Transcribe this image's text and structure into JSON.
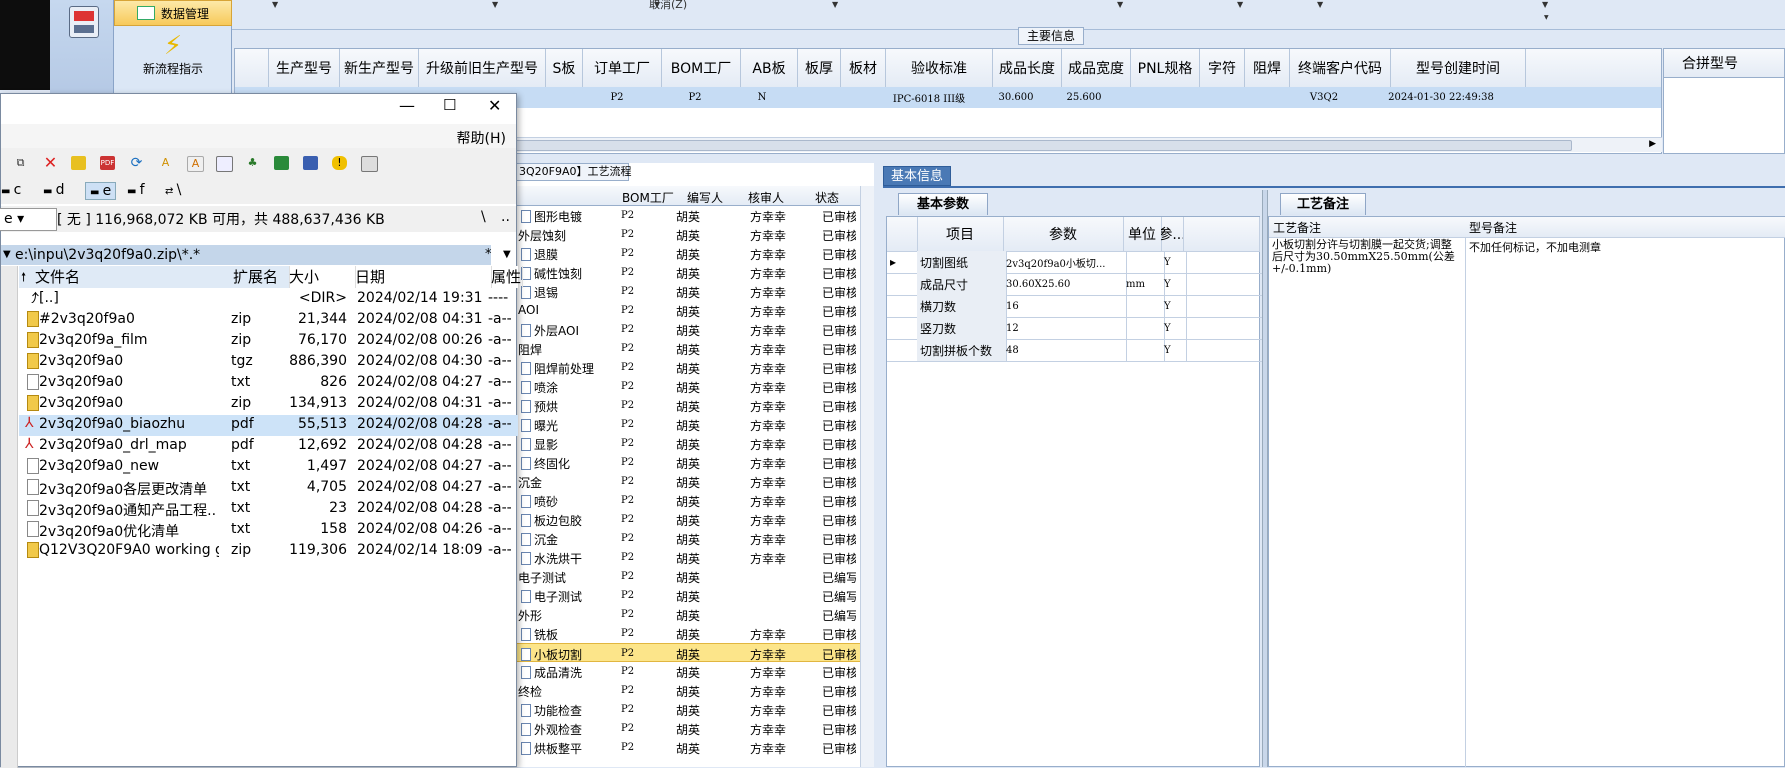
{
  "app": {
    "nav": {
      "data_mgmt": "数据管理",
      "new_flow": "新流程指示"
    },
    "toolbar": {
      "cancel": "取消(Z)"
    },
    "main_info_title": "主要信息",
    "main_grid": {
      "columns": [
        "生产型号",
        "新生产型号",
        "升级前旧生产型号",
        "S板",
        "订单工厂",
        "BOM工厂",
        "AB板",
        "板厚",
        "板材",
        "验收标准",
        "成品长度",
        "成品宽度",
        "PNL规格",
        "字符",
        "阻焊",
        "终端客户代码",
        "型号创建时间"
      ],
      "row": [
        "",
        "",
        "",
        "",
        "P2",
        "P2",
        "N",
        "",
        "",
        "IPC-6018 III级",
        "30.600",
        "25.600",
        "",
        "",
        "",
        "V3Q2",
        "2024-01-30 22:49:38"
      ]
    },
    "merge_grid": {
      "title": "合拼型号"
    },
    "process": {
      "tab_label": "3Q20F9A0】工艺流程",
      "columns": [
        "",
        "BOM工厂",
        "编写人",
        "核审人",
        "状态"
      ],
      "rows": [
        {
          "name": "图形电镀",
          "indent": true,
          "bom": "P2",
          "writer": "胡英",
          "reviewer": "方幸幸",
          "status": "已审核"
        },
        {
          "name": "外层蚀刻",
          "indent": false,
          "bom": "P2",
          "writer": "胡英",
          "reviewer": "方幸幸",
          "status": "已审核"
        },
        {
          "name": "退膜",
          "indent": true,
          "bom": "P2",
          "writer": "胡英",
          "reviewer": "方幸幸",
          "status": "已审核"
        },
        {
          "name": "碱性蚀刻",
          "indent": true,
          "bom": "P2",
          "writer": "胡英",
          "reviewer": "方幸幸",
          "status": "已审核"
        },
        {
          "name": "退锡",
          "indent": true,
          "bom": "P2",
          "writer": "胡英",
          "reviewer": "方幸幸",
          "status": "已审核"
        },
        {
          "name": "AOI",
          "indent": false,
          "bom": "P2",
          "writer": "胡英",
          "reviewer": "方幸幸",
          "status": "已审核"
        },
        {
          "name": "外层AOI",
          "indent": true,
          "bom": "P2",
          "writer": "胡英",
          "reviewer": "方幸幸",
          "status": "已审核"
        },
        {
          "name": "阻焊",
          "indent": false,
          "bom": "P2",
          "writer": "胡英",
          "reviewer": "方幸幸",
          "status": "已审核"
        },
        {
          "name": "阻焊前处理",
          "indent": true,
          "bom": "P2",
          "writer": "胡英",
          "reviewer": "方幸幸",
          "status": "已审核"
        },
        {
          "name": "喷涂",
          "indent": true,
          "bom": "P2",
          "writer": "胡英",
          "reviewer": "方幸幸",
          "status": "已审核"
        },
        {
          "name": "预烘",
          "indent": true,
          "bom": "P2",
          "writer": "胡英",
          "reviewer": "方幸幸",
          "status": "已审核"
        },
        {
          "name": "曝光",
          "indent": true,
          "bom": "P2",
          "writer": "胡英",
          "reviewer": "方幸幸",
          "status": "已审核"
        },
        {
          "name": "显影",
          "indent": true,
          "bom": "P2",
          "writer": "胡英",
          "reviewer": "方幸幸",
          "status": "已审核"
        },
        {
          "name": "终固化",
          "indent": true,
          "bom": "P2",
          "writer": "胡英",
          "reviewer": "方幸幸",
          "status": "已审核"
        },
        {
          "name": "沉金",
          "indent": false,
          "bom": "P2",
          "writer": "胡英",
          "reviewer": "方幸幸",
          "status": "已审核"
        },
        {
          "name": "喷砂",
          "indent": true,
          "bom": "P2",
          "writer": "胡英",
          "reviewer": "方幸幸",
          "status": "已审核"
        },
        {
          "name": "板边包胶",
          "indent": true,
          "bom": "P2",
          "writer": "胡英",
          "reviewer": "方幸幸",
          "status": "已审核"
        },
        {
          "name": "沉金",
          "indent": true,
          "bom": "P2",
          "writer": "胡英",
          "reviewer": "方幸幸",
          "status": "已审核"
        },
        {
          "name": "水洗烘干",
          "indent": true,
          "bom": "P2",
          "writer": "胡英",
          "reviewer": "方幸幸",
          "status": "已审核"
        },
        {
          "name": "电子测试",
          "indent": false,
          "bom": "P2",
          "writer": "胡英",
          "reviewer": "",
          "status": "已编写"
        },
        {
          "name": "电子测试",
          "indent": true,
          "bom": "P2",
          "writer": "胡英",
          "reviewer": "",
          "status": "已编写"
        },
        {
          "name": "外形",
          "indent": false,
          "bom": "P2",
          "writer": "胡英",
          "reviewer": "",
          "status": "已编写"
        },
        {
          "name": "铣板",
          "indent": true,
          "bom": "P2",
          "writer": "胡英",
          "reviewer": "方幸幸",
          "status": "已审核"
        },
        {
          "name": "小板切割",
          "indent": true,
          "bom": "P2",
          "writer": "胡英",
          "reviewer": "方幸幸",
          "status": "已审核",
          "selected": true
        },
        {
          "name": "成品清洗",
          "indent": true,
          "bom": "P2",
          "writer": "胡英",
          "reviewer": "方幸幸",
          "status": "已审核"
        },
        {
          "name": "终检",
          "indent": false,
          "bom": "P2",
          "writer": "胡英",
          "reviewer": "方幸幸",
          "status": "已审核"
        },
        {
          "name": "功能检查",
          "indent": true,
          "bom": "P2",
          "writer": "胡英",
          "reviewer": "方幸幸",
          "status": "已审核"
        },
        {
          "name": "外观检查",
          "indent": true,
          "bom": "P2",
          "writer": "胡英",
          "reviewer": "方幸幸",
          "status": "已审核"
        },
        {
          "name": "烘板整平",
          "indent": true,
          "bom": "P2",
          "writer": "胡英",
          "reviewer": "方幸幸",
          "status": "已审核"
        }
      ]
    },
    "basic_info": {
      "tab": "基本信息",
      "subtab_basic": "基本参数",
      "subtab_proc": "工艺备注",
      "param_columns": [
        "项目",
        "参数",
        "单位",
        "参..."
      ],
      "params": [
        {
          "item": "切割图纸",
          "value": "2v3q20f9a0小板切...",
          "unit": "",
          "flag": "Y"
        },
        {
          "item": "成品尺寸",
          "value": "30.60X25.60",
          "unit": "mm",
          "flag": "Y"
        },
        {
          "item": "横刀数",
          "value": "16",
          "unit": "",
          "flag": "Y"
        },
        {
          "item": "竖刀数",
          "value": "12",
          "unit": "",
          "flag": "Y"
        },
        {
          "item": "切割拼板个数",
          "value": "48",
          "unit": "",
          "flag": "Y"
        }
      ],
      "notes_columns": [
        "工艺备注",
        "型号备注"
      ],
      "process_note": "小板切割分许与切割膜一起交货;调整后尺寸为30.50mmX25.50mm(公差+/-0.1mm)",
      "model_note": "不加任何标记，不加电测章"
    }
  },
  "filemgr": {
    "menu_help": "帮助(H)",
    "drives": [
      "c",
      "d",
      "e",
      "f",
      "\\"
    ],
    "drive_select": "e",
    "free_space": "[ 无 ]  116,968,072 KB 可用，共 488,637,436 KB",
    "path": "e:\\inpu\\2v3q20f9a0.zip\\*.*",
    "columns": [
      "文件名",
      "扩展名",
      "大小",
      "日期",
      "属性"
    ],
    "files": [
      {
        "name": "[..]",
        "ext": "",
        "size": "<DIR>",
        "date": "2024/02/14 19:31",
        "attr": "----",
        "icon": "up"
      },
      {
        "name": "#2v3q20f9a0",
        "ext": "zip",
        "size": "21,344",
        "date": "2024/02/08 04:31",
        "attr": "-a--",
        "icon": "zip"
      },
      {
        "name": "2v3q20f9a_film",
        "ext": "zip",
        "size": "76,170",
        "date": "2024/02/08 00:26",
        "attr": "-a--",
        "icon": "zip"
      },
      {
        "name": "2v3q20f9a0",
        "ext": "tgz",
        "size": "886,390",
        "date": "2024/02/08 04:30",
        "attr": "-a--",
        "icon": "zip"
      },
      {
        "name": "2v3q20f9a0",
        "ext": "txt",
        "size": "826",
        "date": "2024/02/08 04:27",
        "attr": "-a--",
        "icon": "txt"
      },
      {
        "name": "2v3q20f9a0",
        "ext": "zip",
        "size": "134,913",
        "date": "2024/02/08 04:31",
        "attr": "-a--",
        "icon": "zip"
      },
      {
        "name": "2v3q20f9a0_biaozhu",
        "ext": "pdf",
        "size": "55,513",
        "date": "2024/02/08 04:28",
        "attr": "-a--",
        "icon": "pdf",
        "selected": true
      },
      {
        "name": "2v3q20f9a0_drl_map",
        "ext": "pdf",
        "size": "12,692",
        "date": "2024/02/08 04:28",
        "attr": "-a--",
        "icon": "pdf"
      },
      {
        "name": "2v3q20f9a0_new",
        "ext": "txt",
        "size": "1,497",
        "date": "2024/02/08 04:27",
        "attr": "-a--",
        "icon": "txt"
      },
      {
        "name": "2v3q20f9a0各层更改清单",
        "ext": "txt",
        "size": "4,705",
        "date": "2024/02/08 04:27",
        "attr": "-a--",
        "icon": "txt"
      },
      {
        "name": "2v3q20f9a0通知产品工程..",
        "ext": "txt",
        "size": "23",
        "date": "2024/02/08 04:28",
        "attr": "-a--",
        "icon": "txt"
      },
      {
        "name": "2v3q20f9a0优化清单",
        "ext": "txt",
        "size": "158",
        "date": "2024/02/08 04:26",
        "attr": "-a--",
        "icon": "txt"
      },
      {
        "name": "Q12V3Q20F9A0 working g..",
        "ext": "zip",
        "size": "119,306",
        "date": "2024/02/14 18:09",
        "attr": "-a--",
        "icon": "zip"
      }
    ]
  }
}
